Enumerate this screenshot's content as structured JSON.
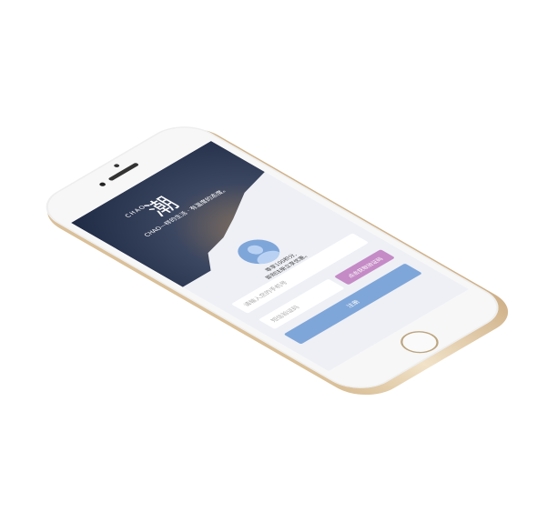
{
  "logo": {
    "mark": "潮",
    "latin": "CHAO"
  },
  "slogan": "CHAO—样的生活 · 有温度的态度。",
  "promo": {
    "line1": "尊享100积分,",
    "line2": "即刻注册立享优惠。"
  },
  "form": {
    "phone_placeholder": "请输入您的手机号",
    "code_placeholder": "短信验证码",
    "get_code_label": "点击获取验证码",
    "register_label": "注册"
  },
  "colors": {
    "accent": "#7fa6d9",
    "code_button": "#c58bc6"
  }
}
